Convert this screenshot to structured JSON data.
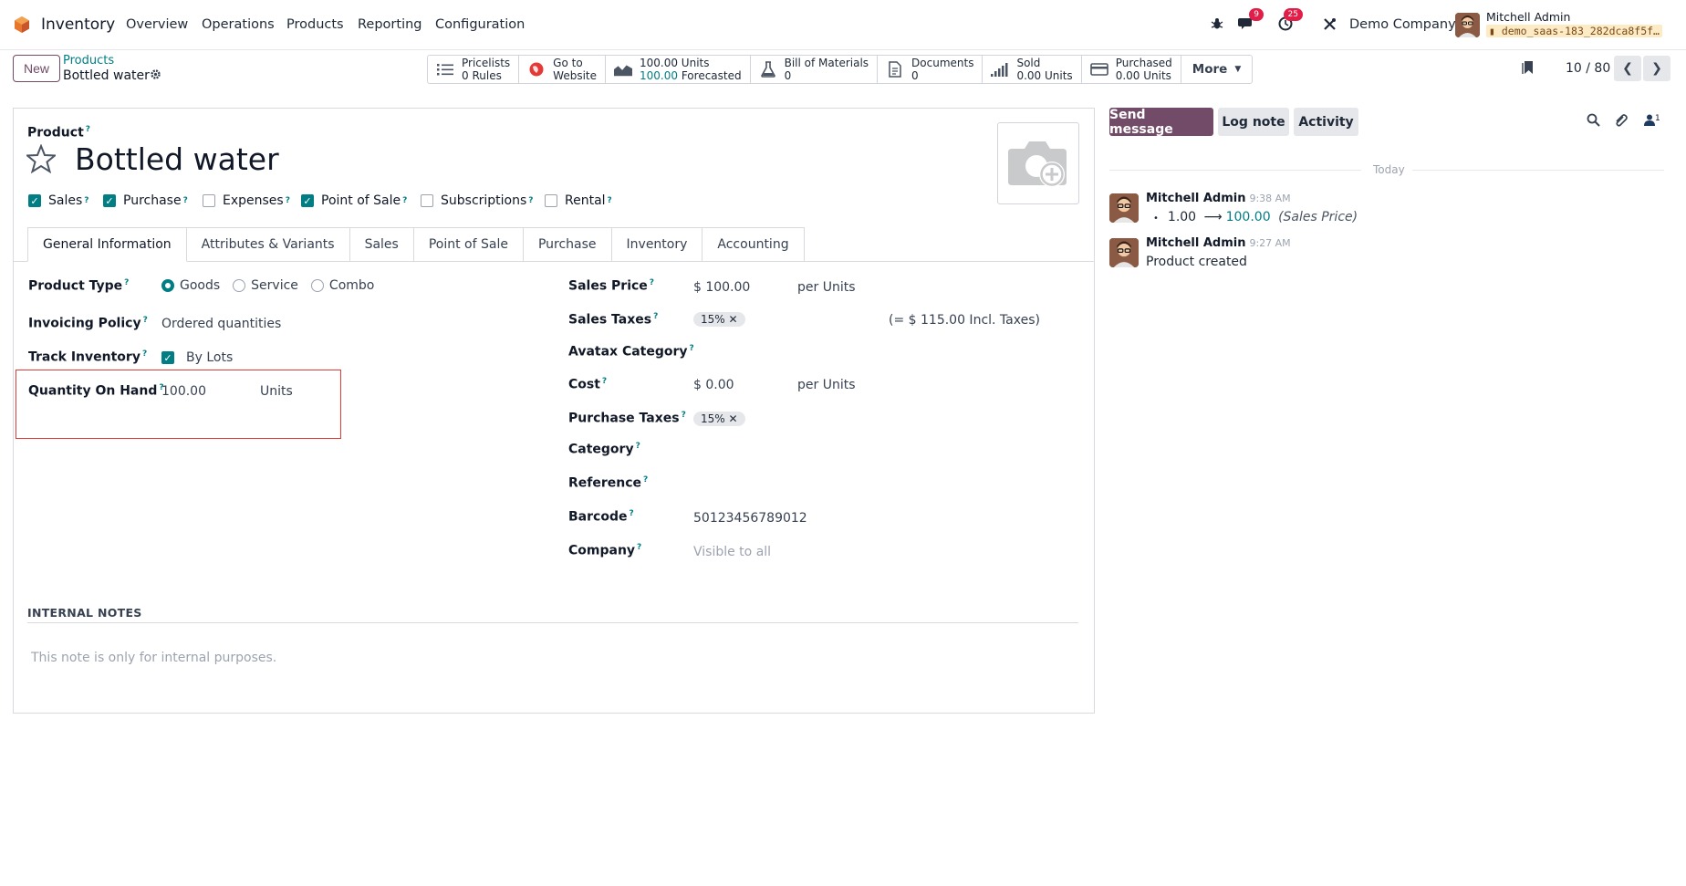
{
  "navbar": {
    "app_name": "Inventory",
    "menu": [
      "Overview",
      "Operations",
      "Products",
      "Reporting",
      "Configuration"
    ],
    "messages_badge": "9",
    "activities_badge": "25",
    "company": "Demo Company",
    "user": "Mitchell Admin",
    "database": "demo_saas-183_282dca8f5f…",
    "brand_color": "#714b67"
  },
  "control": {
    "new_label": "New",
    "breadcrumb_parent": "Products",
    "breadcrumb_current": "Bottled water",
    "smart_buttons": [
      {
        "line1": "Pricelists",
        "line2": "0 Rules",
        "icon": "list-icon"
      },
      {
        "line1": "Go to",
        "line2": "Website",
        "icon": "globe-icon"
      },
      {
        "line1": "100.00 Units",
        "line2_value": "100.00",
        "line2_suffix": "Forecasted",
        "icon": "area-chart-icon"
      },
      {
        "line1": "Bill of Materials",
        "line2": "0",
        "icon": "flask-icon"
      },
      {
        "line1": "Documents",
        "line2": "0",
        "icon": "document-icon"
      },
      {
        "line1": "Sold",
        "line2": "0.00 Units",
        "icon": "signal-icon"
      },
      {
        "line1": "Purchased",
        "line2": "0.00 Units",
        "icon": "credit-card-icon"
      }
    ],
    "more_label": "More",
    "pager": "10 / 80"
  },
  "form": {
    "product_label": "Product",
    "product_name": "Bottled water",
    "checkboxes": [
      {
        "label": "Sales",
        "checked": true
      },
      {
        "label": "Purchase",
        "checked": true
      },
      {
        "label": "Expenses",
        "checked": false
      },
      {
        "label": "Point of Sale",
        "checked": true
      },
      {
        "label": "Subscriptions",
        "checked": false
      },
      {
        "label": "Rental",
        "checked": false
      }
    ],
    "tabs": [
      "General Information",
      "Attributes & Variants",
      "Sales",
      "Point of Sale",
      "Purchase",
      "Inventory",
      "Accounting"
    ],
    "left": {
      "product_type_label": "Product Type",
      "product_type_options": [
        "Goods",
        "Service",
        "Combo"
      ],
      "invoicing_policy_label": "Invoicing Policy",
      "invoicing_policy_value": "Ordered quantities",
      "track_inventory_label": "Track Inventory",
      "track_inventory_value": "By Lots",
      "qty_on_hand_label": "Quantity On Hand",
      "qty_on_hand_value": "100.00",
      "qty_on_hand_uom": "Units"
    },
    "right": {
      "sales_price_label": "Sales Price",
      "sales_price_value": "$ 100.00",
      "sales_price_uom": "per Units",
      "sales_taxes_label": "Sales Taxes",
      "sales_taxes_tag": "15%",
      "sales_taxes_incl": "(= $ 115.00 Incl. Taxes)",
      "avatax_label": "Avatax Category",
      "cost_label": "Cost",
      "cost_value": "$ 0.00",
      "cost_uom": "per Units",
      "purchase_taxes_label": "Purchase Taxes",
      "purchase_taxes_tag": "15%",
      "category_label": "Category",
      "reference_label": "Reference",
      "barcode_label": "Barcode",
      "barcode_value": "50123456789012",
      "company_label": "Company",
      "company_placeholder": "Visible to all"
    },
    "notes_title": "INTERNAL NOTES",
    "notes_placeholder": "This note is only for internal purposes."
  },
  "chatter": {
    "send_message": "Send message",
    "log_note": "Log note",
    "activity": "Activity",
    "followers_count": "1",
    "today": "Today",
    "messages": [
      {
        "author": "Mitchell Admin",
        "time": "9:38 AM",
        "old": "1.00",
        "new": "100.00",
        "field": "(Sales Price)"
      },
      {
        "author": "Mitchell Admin",
        "time": "9:27 AM",
        "body": "Product created"
      }
    ]
  }
}
